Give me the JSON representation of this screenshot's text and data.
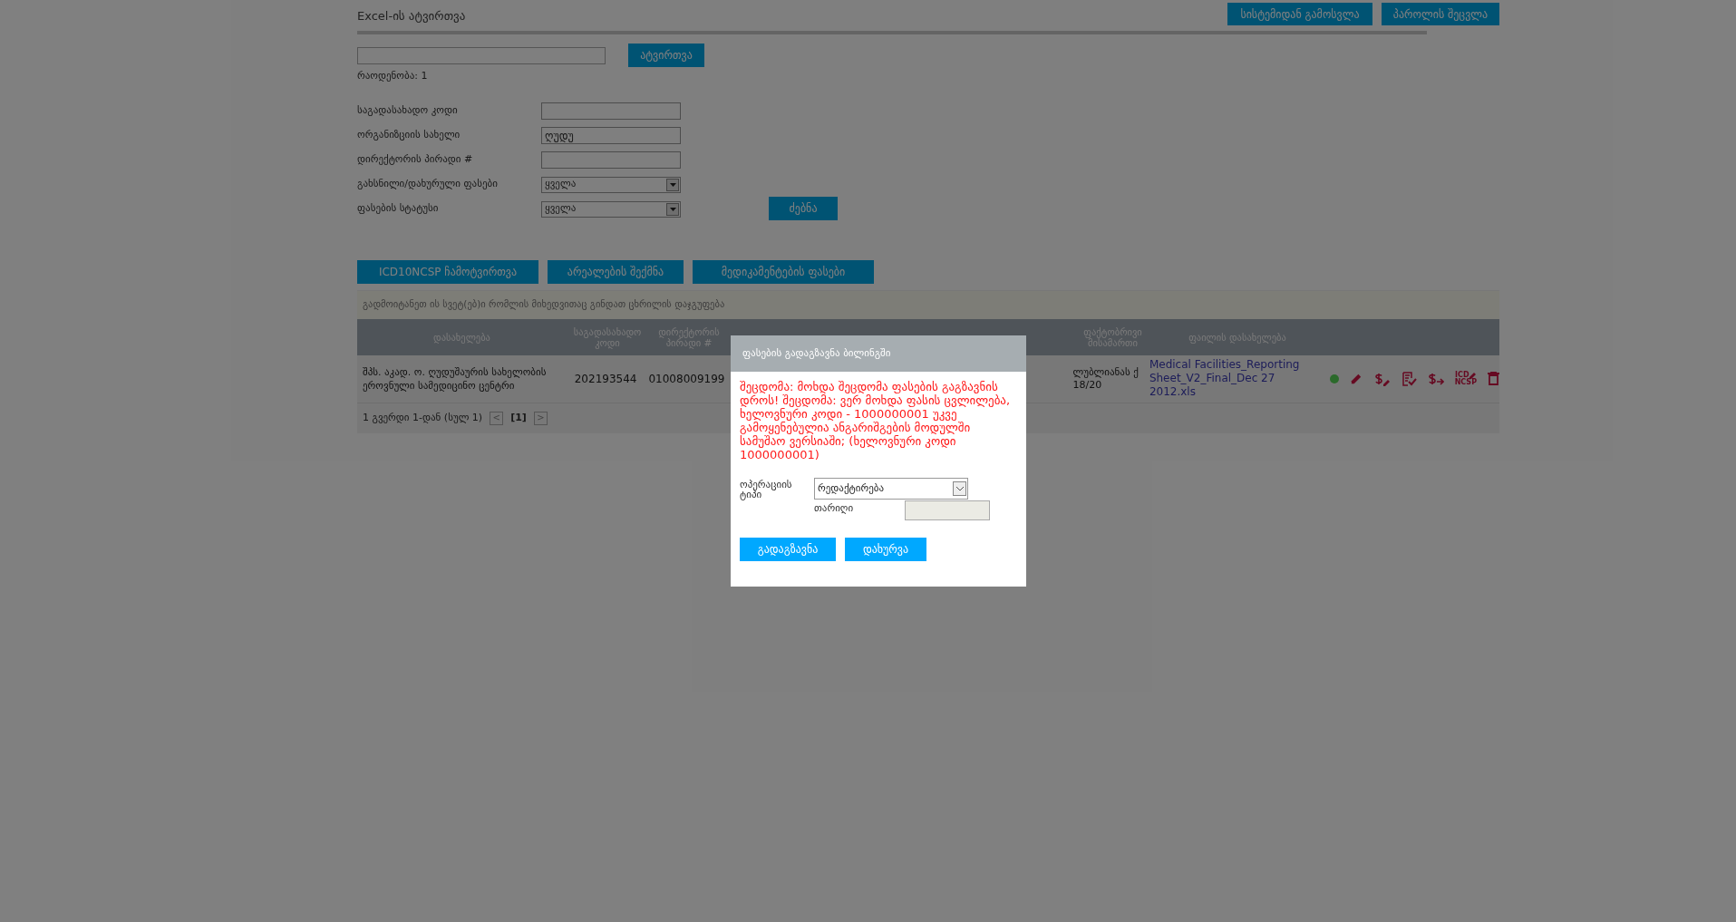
{
  "header": {
    "title": "Excel-ის ატვირთვა",
    "buttons": [
      "სისტემიდან გამოსვლა",
      "პაროლის შეცვლა"
    ]
  },
  "upload": {
    "button": "ატვირთვა",
    "count": "რაოდენობა: 1"
  },
  "filters": [
    {
      "label": "საგადასახადო კოდი",
      "kind": "text"
    },
    {
      "label": "ორგანიზციის სახელი",
      "kind": "text",
      "value": "ღუდუ"
    },
    {
      "label": "დირექტორის პირადი #",
      "kind": "text"
    },
    {
      "label": "გახსნილი/დახურული ფასები",
      "kind": "select",
      "value": "ყველა"
    },
    {
      "label": "ფასების სტატუსი",
      "kind": "select",
      "value": "ყველა"
    }
  ],
  "search_button": "ძებნა",
  "actions": [
    "ICD10NCSP ჩამოტვირთვა",
    "არეალების შექმნა",
    "მედიკამენტების ფასები"
  ],
  "group_hint": "გადმოიტანეთ ის სვეტ(ებ)ი რომლის მიხედვითაც გინდათ ცხრილის დაჯგუფება",
  "table": {
    "columns": [
      "დასახელება",
      "საგადასახადო კოდი",
      "დირექტორის პირადი #",
      null,
      null,
      null,
      "ფაქტობრივი მისამართი",
      "ფაილის დასახელება"
    ],
    "rows": [
      {
        "name": "შპს. აკად. ო. ღუდუშაურის სახელობის ეროვნული სამედიცინო ცენტრი",
        "tax_code": "202193544",
        "director_id": "01008009199",
        "address": "ლუბლიანას ქ 18/20",
        "file": "Medical Facilities_Reporting Sheet_V2_Final_Dec 27 2012.xls",
        "color": "#2b6a2b",
        "row_actions": [
          {
            "kind": "edit"
          },
          {
            "kind": "price-edit"
          },
          {
            "kind": "approve"
          },
          {
            "kind": "price-send"
          },
          {
            "kind": "icd",
            "label_top": "ICD",
            "label_bottom": "NCSP"
          },
          {
            "kind": "delete"
          }
        ]
      }
    ]
  },
  "pager": {
    "text": "1 გვერდი 1-დან (სულ 1)",
    "prev": "<",
    "page": "[1]",
    "next": ">"
  },
  "dialog": {
    "title": "ფასების გადაგზავნა ბილინგში",
    "error": "შეცდომა: მოხდა შეცდომა ფასების გაგზავნის დროს! შეცდომა: ვერ მოხდა ფასის ცვლილება, ხელოვნური კოდი - 1000000001 უკვე გამოყენებულია ანგარიშგების მოდულში სამუშაო ვერსიაში; (ხელოვნური კოდი 1000000001)",
    "operation_label": "ოპერაციის ტიპი",
    "operation_value": "რედაქტირება",
    "date_label": "თარიღი",
    "date_disabled": true,
    "buttons": [
      "გადაგზავნა",
      "დახურვა"
    ]
  }
}
